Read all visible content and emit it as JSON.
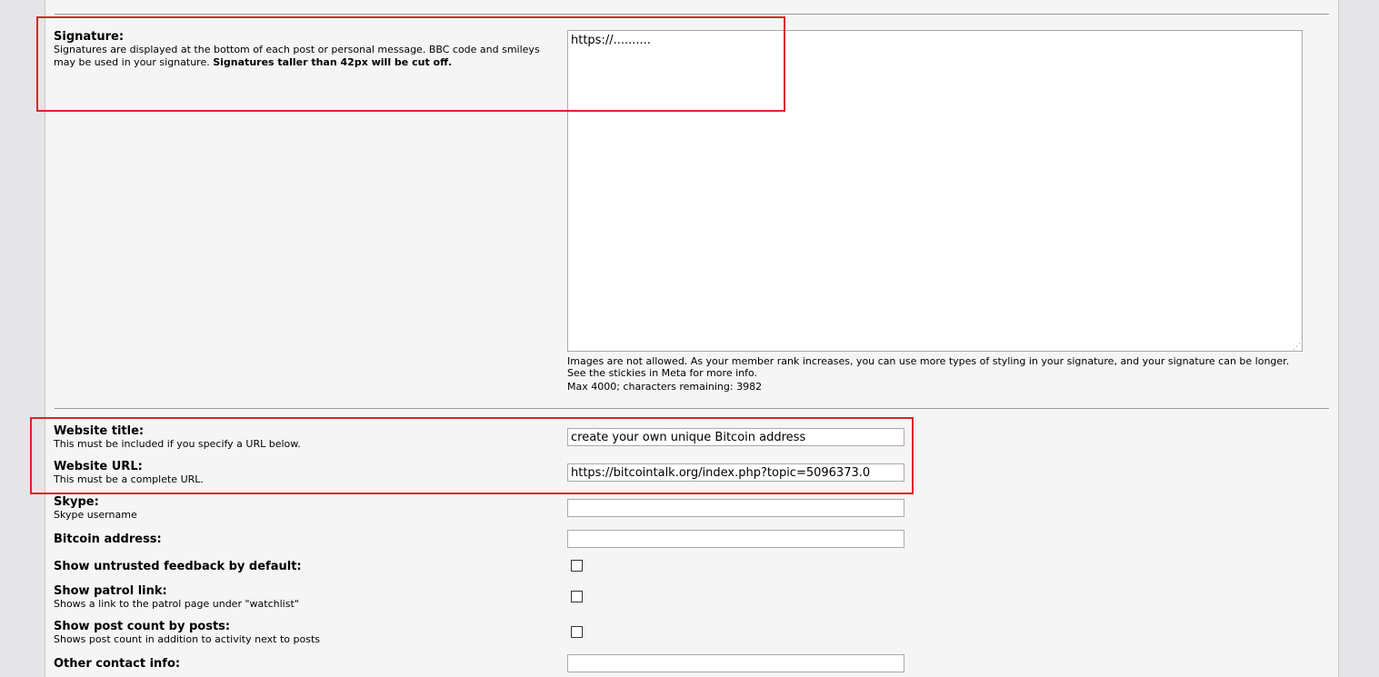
{
  "signature": {
    "title": "Signature:",
    "desc_plain": "Signatures are displayed at the bottom of each post or personal message. BBC code and smileys may be used in your signature.",
    "desc_bold": "Signatures taller than 42px will be cut off.",
    "value": "https://..........",
    "note_line1": "Images are not allowed. As your member rank increases, you can use more types of styling in your signature, and your signature can be longer.",
    "note_line2": "See the stickies in Meta for more info.",
    "max_label": "Max 4000; characters remaining:",
    "chars_remaining": "3982"
  },
  "website_title": {
    "title": "Website title:",
    "desc": "This must be included if you specify a URL below.",
    "value": "create your own unique Bitcoin address"
  },
  "website_url": {
    "title": "Website URL:",
    "desc": "This must be a complete URL.",
    "value": "https://bitcointalk.org/index.php?topic=5096373.0"
  },
  "skype": {
    "title": "Skype:",
    "desc": "Skype username",
    "value": ""
  },
  "bitcoin_address": {
    "title": "Bitcoin address:",
    "value": ""
  },
  "untrusted_feedback": {
    "title": "Show untrusted feedback by default:",
    "checked": false
  },
  "patrol_link": {
    "title": "Show patrol link:",
    "desc": "Shows a link to the patrol page under \"watchlist\"",
    "checked": false
  },
  "post_count": {
    "title": "Show post count by posts:",
    "desc": "Shows post count in addition to activity next to posts",
    "checked": false
  },
  "other_contact": {
    "title": "Other contact info:",
    "value": ""
  },
  "colors": {
    "highlight_box": "#d9252a",
    "panel_bg": "#f5f5f5",
    "page_bg": "#e5e5e8"
  }
}
